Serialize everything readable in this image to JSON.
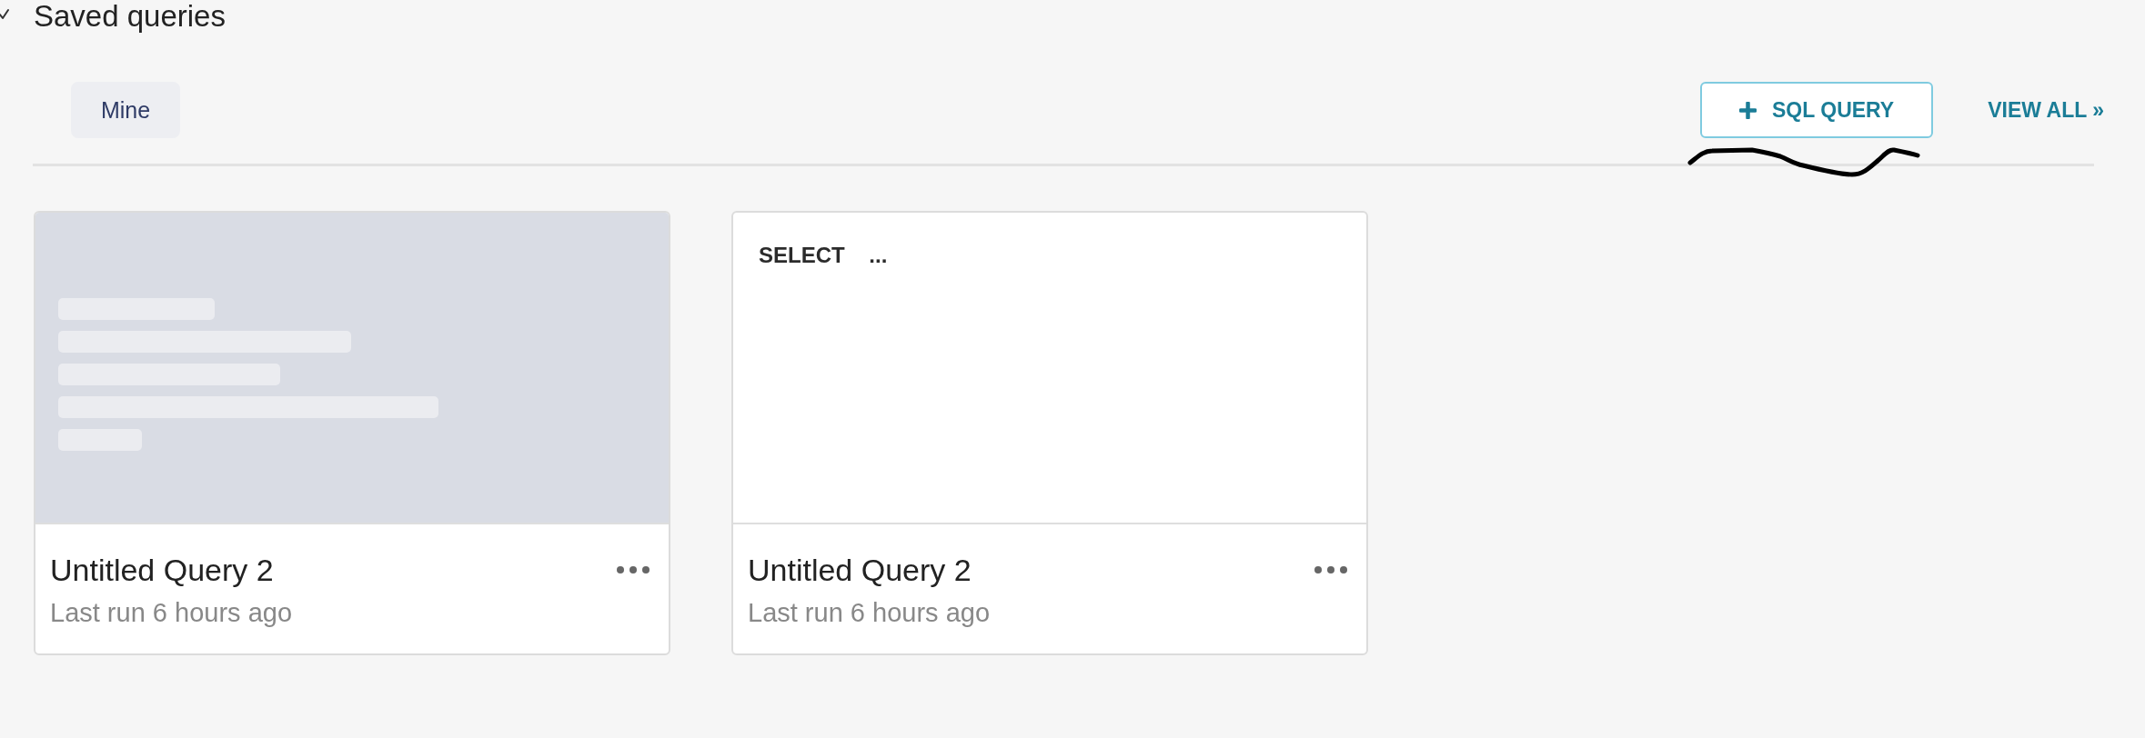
{
  "section": {
    "title": "Saved queries",
    "expanded": true
  },
  "tabs": [
    {
      "label": "Mine",
      "selected": true
    }
  ],
  "actions": {
    "new_query_button": {
      "label": "SQL QUERY"
    },
    "view_all_link": {
      "label": "VIEW ALL »"
    }
  },
  "queries": [
    {
      "kind": "placeholder",
      "title": "Untitled Query 2",
      "subtitle": "Last run 6 hours ago"
    },
    {
      "kind": "sql",
      "preview": "SELECT ...",
      "title": "Untitled Query 2",
      "subtitle": "Last run 6 hours ago"
    }
  ]
}
